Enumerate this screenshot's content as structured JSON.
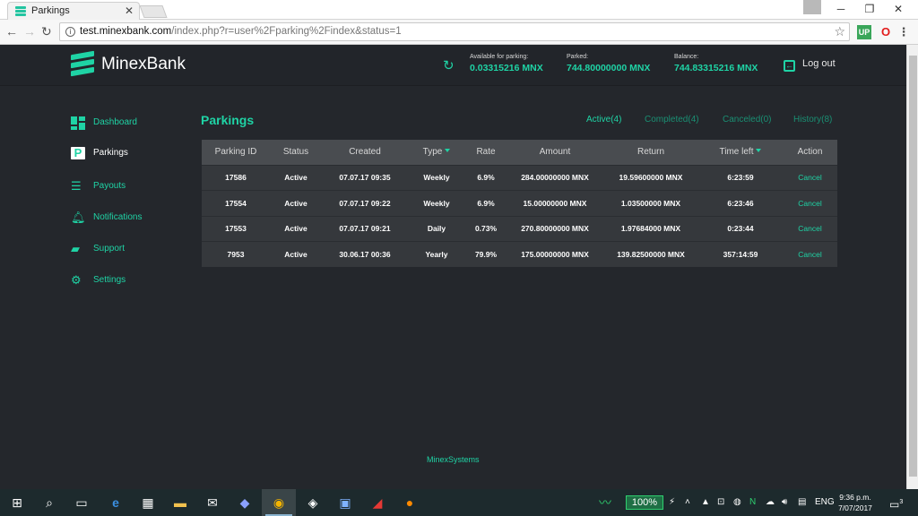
{
  "browser": {
    "tab_title": "Parkings",
    "url_host": "test.minexbank.com",
    "url_path": "/index.php?r=user%2Fparking%2Findex&status=1",
    "ext1": "UP",
    "ext2": "O"
  },
  "header": {
    "brand": "MinexBank",
    "available_label": "Available for parking:",
    "available_value": "0.03315216 MNX",
    "parked_label": "Parked:",
    "parked_value": "744.80000000 MNX",
    "balance_label": "Balance:",
    "balance_value": "744.83315216 MNX",
    "logout": "Log out"
  },
  "sidebar": {
    "items": [
      {
        "label": "Dashboard",
        "icon": "dashboard-icon"
      },
      {
        "label": "Parkings",
        "icon": "parking-icon"
      },
      {
        "label": "Payouts",
        "icon": "list-icon"
      },
      {
        "label": "Notifications",
        "icon": "bell-icon"
      },
      {
        "label": "Support",
        "icon": "chat-icon"
      },
      {
        "label": "Settings",
        "icon": "gear-icon"
      }
    ]
  },
  "main": {
    "title": "Parkings",
    "tabs": [
      "Active(4)",
      "Completed(4)",
      "Canceled(0)",
      "History(8)"
    ],
    "columns": [
      "Parking ID",
      "Status",
      "Created",
      "Type",
      "Rate",
      "Amount",
      "Return",
      "Time left",
      "Action"
    ],
    "rows": [
      [
        "17586",
        "Active",
        "07.07.17 09:35",
        "Weekly",
        "6.9%",
        "284.00000000 MNX",
        "19.59600000 MNX",
        "6:23:59",
        "Cancel"
      ],
      [
        "17554",
        "Active",
        "07.07.17 09:22",
        "Weekly",
        "6.9%",
        "15.00000000 MNX",
        "1.03500000 MNX",
        "6:23:46",
        "Cancel"
      ],
      [
        "17553",
        "Active",
        "07.07.17 09:21",
        "Daily",
        "0.73%",
        "270.80000000 MNX",
        "1.97684000 MNX",
        "0:23:44",
        "Cancel"
      ],
      [
        "7953",
        "Active",
        "30.06.17 00:36",
        "Yearly",
        "79.9%",
        "175.00000000 MNX",
        "139.82500000 MNX",
        "357:14:59",
        "Cancel"
      ]
    ]
  },
  "footer": "MinexSystems",
  "taskbar": {
    "battery": "100%",
    "lang": "ENG",
    "time": "9:36 p.m.",
    "date": "7/07/2017",
    "notif_count": "3"
  },
  "colors": {
    "accent": "#1fd3a5",
    "background": "#24272c",
    "table_header": "#494c50",
    "table_row": "#35383c"
  }
}
